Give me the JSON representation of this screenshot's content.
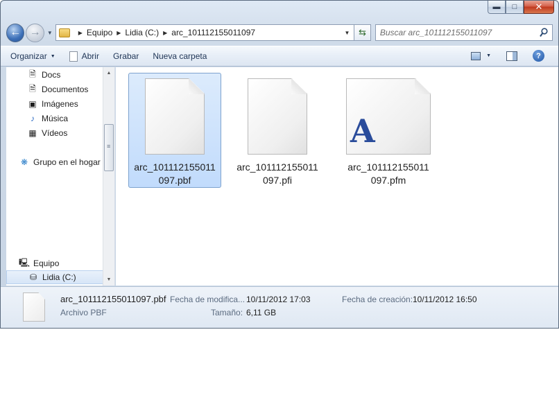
{
  "window": {
    "caption_buttons": {
      "minimize": "▬",
      "maximize": "□",
      "close": "✕"
    }
  },
  "address": {
    "breadcrumbs": [
      "Equipo",
      "Lidia (C:)",
      "arc_101112155011097"
    ]
  },
  "search": {
    "placeholder": "Buscar arc_101112155011097"
  },
  "toolbar": {
    "organize": "Organizar",
    "open": "Abrir",
    "burn": "Grabar",
    "new_folder": "Nueva carpeta",
    "help": "?"
  },
  "sidebar": {
    "items": [
      {
        "label": "Docs",
        "icon": "documents-library-icon"
      },
      {
        "label": "Documentos",
        "icon": "documents-library-icon"
      },
      {
        "label": "Imágenes",
        "icon": "pictures-library-icon"
      },
      {
        "label": "Música",
        "icon": "music-library-icon"
      },
      {
        "label": "Vídeos",
        "icon": "videos-library-icon"
      },
      {
        "label": "Grupo en el hogar",
        "icon": "homegroup-icon"
      },
      {
        "label": "Equipo",
        "icon": "computer-icon"
      },
      {
        "label": "Lidia (C:)",
        "icon": "drive-icon"
      }
    ]
  },
  "files": [
    {
      "name": "arc_101112155011097.pbf",
      "name_line1": "arc_101112155011",
      "name_line2": "097.pbf",
      "icon": "blank-file-icon",
      "selected": true
    },
    {
      "name": "arc_101112155011097.pfi",
      "name_line1": "arc_101112155011",
      "name_line2": "097.pfi",
      "icon": "blank-file-icon",
      "selected": false
    },
    {
      "name": "arc_101112155011097.pfm",
      "name_line1": "arc_101112155011",
      "name_line2": "097.pfm",
      "icon": "font-file-icon",
      "glyph": "A",
      "selected": false
    }
  ],
  "details": {
    "file_name": "arc_101112155011097.pbf",
    "file_type": "Archivo PBF",
    "modified_label": "Fecha de modifica...",
    "modified_value": "10/11/2012 17:03",
    "size_label": "Tamaño:",
    "size_value": "6,11 GB",
    "created_label": "Fecha de creación:",
    "created_value": "10/11/2012 16:50"
  },
  "colors": {
    "selection": "#c1dbfc",
    "font_glyph": "#2a4c9b",
    "window_frame": "#cfdbe9"
  }
}
